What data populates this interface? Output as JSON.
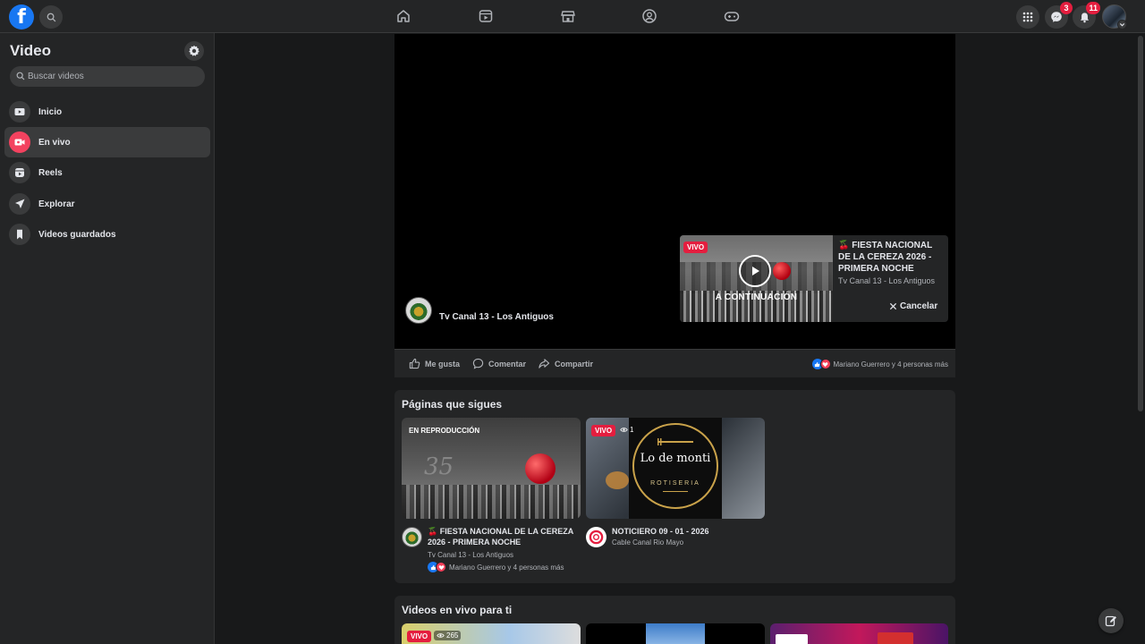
{
  "colors": {
    "accent": "#1877f2",
    "live": "#e41e3f",
    "bg": "#18191a",
    "surface": "#242526"
  },
  "topbar": {
    "logo_letter": "f",
    "nav_icons": [
      "home-icon",
      "watch-icon",
      "marketplace-icon",
      "groups-icon",
      "gaming-icon"
    ],
    "messenger_badge": "3",
    "notifications_badge": "11"
  },
  "sidebar": {
    "title": "Video",
    "search_placeholder": "Buscar videos",
    "items": [
      {
        "label": "Inicio",
        "icon": "video-home-icon"
      },
      {
        "label": "En vivo",
        "icon": "live-icon",
        "active": true
      },
      {
        "label": "Reels",
        "icon": "reels-icon"
      },
      {
        "label": "Explorar",
        "icon": "explore-icon"
      },
      {
        "label": "Videos guardados",
        "icon": "bookmark-icon"
      }
    ]
  },
  "player": {
    "channel_name": "Tv Canal 13 - Los Antiguos",
    "up_next": {
      "badge": "VIVO",
      "overlay_text": "A CONTINUACIÓN",
      "title": "🍒 FIESTA NACIONAL DE LA CEREZA 2026 - PRIMERA NOCHE",
      "channel": "Tv Canal 13 - Los Antiguos",
      "cancel_label": "Cancelar"
    }
  },
  "actions": {
    "like": "Me gusta",
    "comment": "Comentar",
    "share": "Compartir",
    "reactions_text": "Mariano Guerrero y 4 personas más"
  },
  "pages_section": {
    "title": "Páginas que sigues",
    "cards": [
      {
        "overlay_label": "EN REPRODUCCIÓN",
        "title": "🍒 FIESTA NACIONAL DE LA CEREZA 2026 - PRIMERA NOCHE",
        "channel": "Tv Canal 13 - Los Antiguos",
        "reactions_text": "Mariano Guerrero y 4 personas más"
      },
      {
        "badge": "VIVO",
        "viewers": "1",
        "logo_text": "Lo de monti",
        "logo_sub": "ROTISERIA",
        "title": "NOTICIERO 09 - 01 - 2026",
        "channel": "Cable Canal Rio Mayo"
      }
    ]
  },
  "live_section": {
    "title": "Videos en vivo para ti",
    "first_badge": "VIVO",
    "first_viewers": "265"
  }
}
